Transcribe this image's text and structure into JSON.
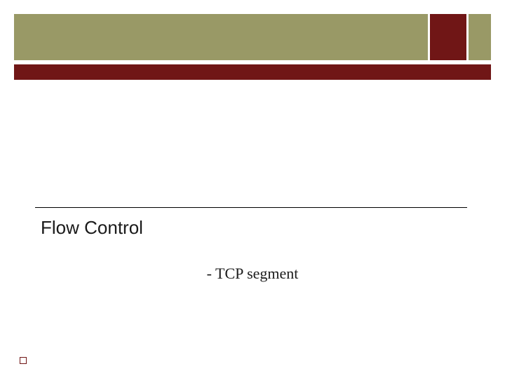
{
  "colors": {
    "olive": "#999966",
    "maroon": "#701616",
    "text": "#1a1a1a"
  },
  "slide": {
    "title": "Flow Control",
    "subtitle": "- TCP segment"
  }
}
